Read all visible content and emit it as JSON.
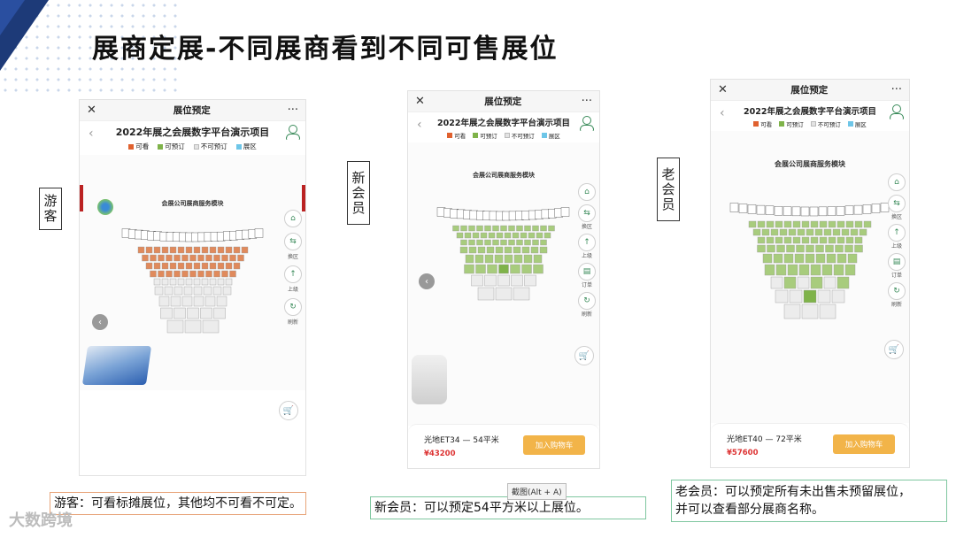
{
  "slide": {
    "title": "展商定展-不同展商看到不同可售展位"
  },
  "phones": [
    {
      "key": "visitor",
      "tag": "游客",
      "topbar": {
        "close": "✕",
        "title": "展位预定",
        "more": "···"
      },
      "header_title": "2022年展之会展数字平台演示项目",
      "legend": [
        {
          "label": "可看",
          "color": "#e0612f"
        },
        {
          "label": "可预订",
          "color": "#7fb34a"
        },
        {
          "label": "不可预订",
          "color": "#e3e3e3"
        },
        {
          "label": "展区",
          "color": "#6ec6e8"
        }
      ],
      "map_title": "会展公司展商服务模块",
      "side_buttons": [
        {
          "icon": "⌂",
          "label": ""
        },
        {
          "icon": "⇆",
          "label": "换区"
        },
        {
          "icon": "↑",
          "label": "上级"
        },
        {
          "icon": "↻",
          "label": "刷新"
        }
      ],
      "caption": "游客：可看标摊展位，其他均不可看不可定。"
    },
    {
      "key": "new-member",
      "tag": "新会员",
      "topbar": {
        "close": "✕",
        "title": "展位预定",
        "more": "···"
      },
      "header_title": "2022年展之会展数字平台演示项目",
      "legend": [
        {
          "label": "可看",
          "color": "#e0612f"
        },
        {
          "label": "可预订",
          "color": "#7fb34a"
        },
        {
          "label": "不可预订",
          "color": "#e3e3e3"
        },
        {
          "label": "展区",
          "color": "#6ec6e8"
        }
      ],
      "map_title": "会展公司展商服务模块",
      "side_buttons": [
        {
          "icon": "⌂",
          "label": ""
        },
        {
          "icon": "⇆",
          "label": "换区"
        },
        {
          "icon": "↑",
          "label": "上级"
        },
        {
          "icon": "▤",
          "label": "订单"
        },
        {
          "icon": "↻",
          "label": "刷新"
        }
      ],
      "booth": {
        "name": "光地ET34 — 54平米",
        "price": "¥43200",
        "button": "加入购物车"
      },
      "caption": "新会员：可以预定54平方米以上展位。"
    },
    {
      "key": "old-member",
      "tag": "老会员",
      "topbar": {
        "close": "✕",
        "title": "展位预定",
        "more": "···"
      },
      "header_title": "2022年展之会展数字平台演示项目",
      "legend": [
        {
          "label": "可看",
          "color": "#e0612f"
        },
        {
          "label": "可预订",
          "color": "#7fb34a"
        },
        {
          "label": "不可预订",
          "color": "#e3e3e3"
        },
        {
          "label": "展区",
          "color": "#6ec6e8"
        }
      ],
      "map_title": "会展公司展商服务模块",
      "side_buttons": [
        {
          "icon": "⌂",
          "label": ""
        },
        {
          "icon": "⇆",
          "label": "换区"
        },
        {
          "icon": "↑",
          "label": "上级"
        },
        {
          "icon": "▤",
          "label": "订单"
        },
        {
          "icon": "↻",
          "label": "刷新"
        }
      ],
      "booth": {
        "name": "光地ET40 — 72平米",
        "price": "¥57600",
        "button": "加入购物车"
      },
      "caption_lines": [
        "老会员：可以预定所有未出售未预留展位，",
        "并可以查看部分展商名称。"
      ]
    }
  ],
  "tooltip": "截图(Alt + A)",
  "watermark": "大数跨境"
}
